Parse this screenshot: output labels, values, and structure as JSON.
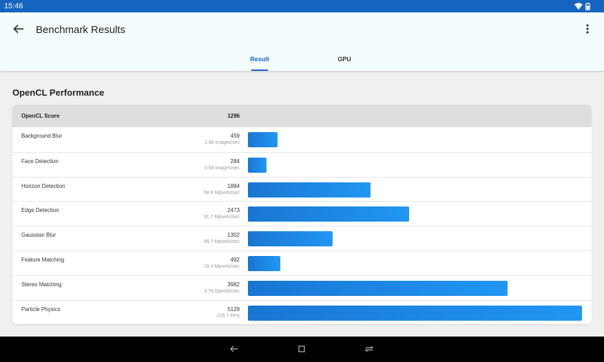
{
  "status_bar": {
    "time": "15:46"
  },
  "app_bar": {
    "title": "Benchmark Results"
  },
  "tabs": [
    {
      "label": "Result"
    },
    {
      "label": "GPU"
    }
  ],
  "section_title": "OpenCL Performance",
  "summary": {
    "label": "OpenCL Score",
    "score": "1296"
  },
  "max_score": 5129,
  "rows": [
    {
      "name": "Background Blur",
      "score": "459",
      "unit": "1.90 images/sec"
    },
    {
      "name": "Face Detection",
      "score": "284",
      "unit": "0.93 images/sec"
    },
    {
      "name": "Horizon Detection",
      "score": "1884",
      "unit": "58.6 Mpixels/sec"
    },
    {
      "name": "Edge Detection",
      "score": "2473",
      "unit": "91.7 Mpixels/sec"
    },
    {
      "name": "Gaussian Blur",
      "score": "1302",
      "unit": "56.7 Mpixels/sec"
    },
    {
      "name": "Feature Matching",
      "score": "492",
      "unit": "19.4 Mpixels/sec"
    },
    {
      "name": "Stereo Matching",
      "score": "3982",
      "unit": "3.79 Gpixels/sec"
    },
    {
      "name": "Particle Physics",
      "score": "5129",
      "unit": "225.7 FPS"
    }
  ],
  "colors": {
    "accent": "#1565c0",
    "bar_start": "#1976d2",
    "bar_end": "#2196f3"
  }
}
